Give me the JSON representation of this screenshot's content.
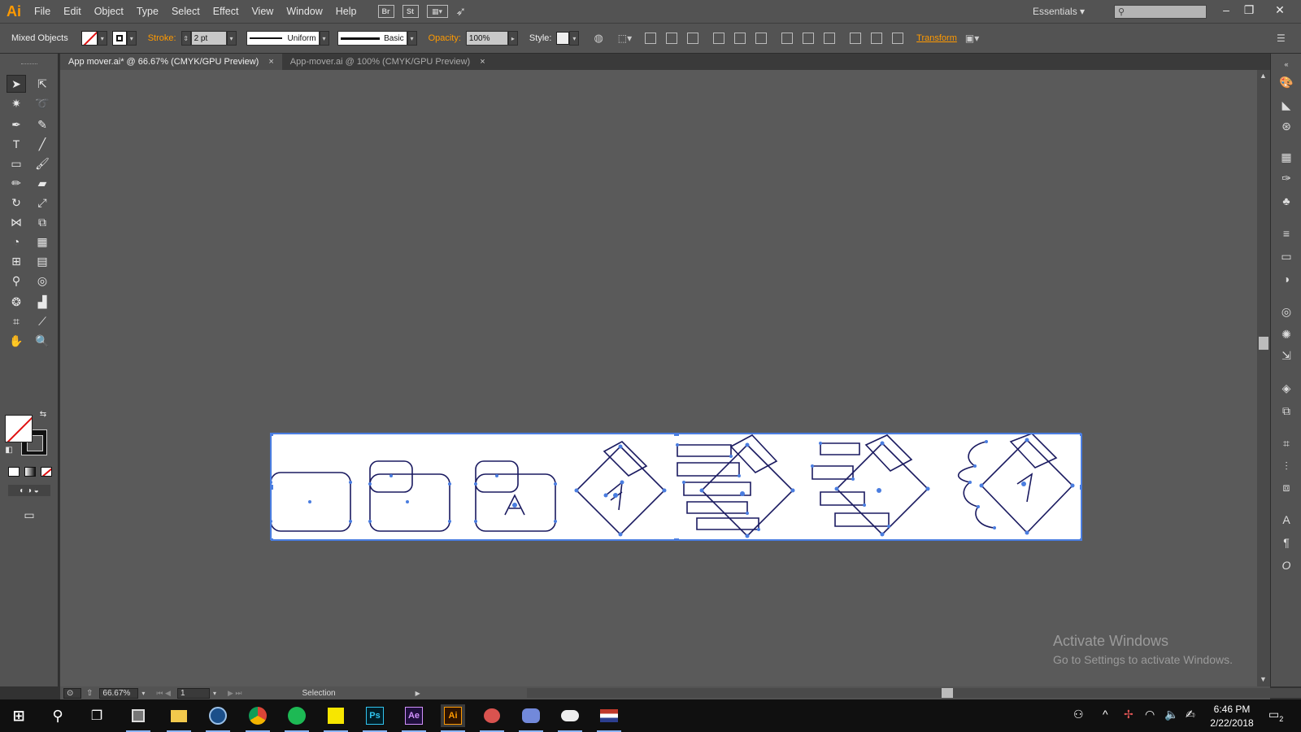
{
  "app": {
    "logo": "Ai",
    "menu": [
      "File",
      "Edit",
      "Object",
      "Type",
      "Select",
      "Effect",
      "View",
      "Window",
      "Help"
    ],
    "bridge_label": "Br",
    "stock_label": "St",
    "workspace": "Essentials"
  },
  "control_bar": {
    "selection_type": "Mixed Objects",
    "stroke_label": "Stroke:",
    "stroke_weight": "2 pt",
    "profile": "Uniform",
    "brush": "Basic",
    "opacity_label": "Opacity:",
    "opacity_value": "100%",
    "style_label": "Style:",
    "transform_label": "Transform"
  },
  "tabs": [
    {
      "label": "App mover.ai* @ 66.67% (CMYK/GPU Preview)",
      "active": true
    },
    {
      "label": "App-mover.ai @ 100% (CMYK/GPU Preview)",
      "active": false
    }
  ],
  "tab_close": "×",
  "status_bar": {
    "zoom": "66.67%",
    "artboard_number": "1",
    "current_tool": "Selection"
  },
  "watermark": {
    "line1": "Activate Windows",
    "line2": "Go to Settings to activate Windows."
  },
  "taskbar": {
    "apps": [
      "start",
      "search",
      "task-view",
      "app-dark",
      "file-explorer",
      "steam",
      "chrome",
      "spotify",
      "kakao-player",
      "photoshop",
      "after-effects",
      "illustrator",
      "app-fruit",
      "discord",
      "app-owl",
      "app-flag"
    ],
    "photoshop_label": "Ps",
    "after_effects_label": "Ae",
    "illustrator_label": "Ai",
    "time": "6:46 PM",
    "date": "2/22/2018",
    "notifications_count": "2"
  },
  "colors": {
    "selection": "#4a7de0",
    "accent_orange": "#ff9a00",
    "ui_panel": "#535353",
    "canvas": "#5a5a5a"
  }
}
